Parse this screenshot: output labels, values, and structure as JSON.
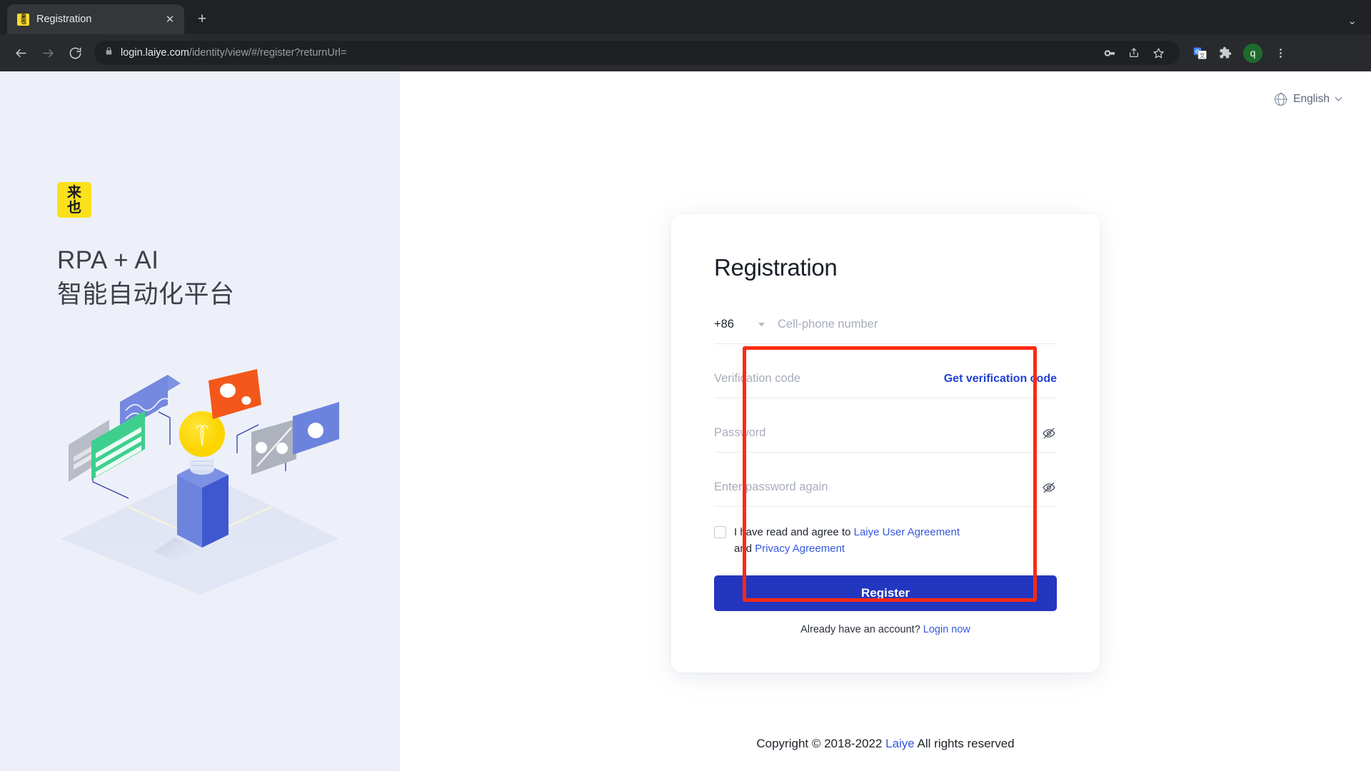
{
  "browser": {
    "tab": {
      "title": "Registration",
      "favicon_name": "laiye-favicon",
      "close_label": "✕"
    },
    "new_tab_label": "+",
    "window_controls": {
      "collapse": "⌄"
    },
    "nav": {
      "back": "←",
      "forward": "→",
      "reload": "⟳"
    },
    "omnibox": {
      "lock_icon": "🔒",
      "url_host": "login.laiye.com",
      "url_path": "/identity/view/#/register?returnUrl=",
      "full_url": "login.laiye.com/identity/view/#/register?returnUrl="
    },
    "toolbar_icons": [
      {
        "name": "password-key-icon",
        "glyph": "⚷"
      },
      {
        "name": "share-icon",
        "glyph": "⇧"
      },
      {
        "name": "bookmark-star-icon",
        "glyph": "☆"
      },
      {
        "name": "google-translate-icon",
        "glyph": "G"
      },
      {
        "name": "extensions-puzzle-icon",
        "glyph": "🧩"
      },
      {
        "name": "profile-avatar",
        "glyph": "q"
      },
      {
        "name": "chrome-menu-icon",
        "glyph": "⋮"
      }
    ]
  },
  "left_panel": {
    "logo_line1": "来",
    "logo_line2": "也",
    "tagline_line1": "RPA + AI",
    "tagline_line2": "智能自动化平台",
    "illustration_name": "isometric-lightbulb-platform-illustration"
  },
  "language": {
    "icon": "globe-icon",
    "label": "English",
    "caret": "chevron-down-icon"
  },
  "registration": {
    "title": "Registration",
    "country_code": "+86",
    "phone_placeholder": "Cell-phone number",
    "phone_value": "",
    "verification_placeholder": "Verification code",
    "verification_value": "",
    "get_code_label": "Get verification code",
    "password_placeholder": "Password",
    "password_value": "",
    "password_confirm_placeholder": "Enter password again",
    "password_confirm_value": "",
    "agree_prefix": "I have read and agree to ",
    "agree_link_user": "Laiye User Agreement",
    "agree_middle": " and ",
    "agree_link_privacy": "Privacy Agreement",
    "register_label": "Register",
    "have_account_text": "Already have an account? ",
    "login_now_label": "Login now"
  },
  "footer": {
    "copyright_prefix": "Copyright © 2018-2022 ",
    "copyright_link": "Laiye",
    "copyright_suffix": " All rights reserved"
  },
  "annotation": {
    "name": "red-highlight-box",
    "color": "#FB2A12",
    "target": "registration-form-fields"
  },
  "colors": {
    "brand_yellow": "#FBE01C",
    "primary_blue": "#2236C0",
    "link_blue": "#2140D4",
    "left_panel_bg": "#EDF0F8",
    "annotation_red": "#FB2A12"
  }
}
